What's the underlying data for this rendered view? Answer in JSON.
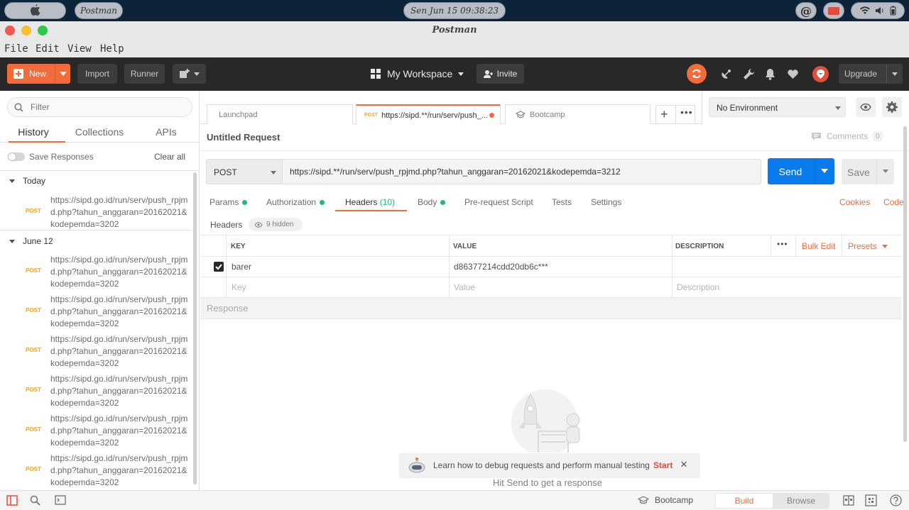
{
  "os": {
    "clock": "Sen Jun 15 09:38:23",
    "app_pill": "Postman"
  },
  "window": {
    "title": "Postman"
  },
  "menu": [
    "File",
    "Edit",
    "View",
    "Help"
  ],
  "header": {
    "new_label": "New",
    "import_label": "Import",
    "runner_label": "Runner",
    "workspace_label": "My Workspace",
    "invite_label": "Invite",
    "upgrade_label": "Upgrade"
  },
  "sidebar": {
    "filter_placeholder": "Filter",
    "tabs": [
      "History",
      "Collections",
      "APIs"
    ],
    "save_responses": "Save Responses",
    "clear_all": "Clear all",
    "groups": [
      {
        "label": "Today"
      },
      {
        "label": "June 12"
      }
    ],
    "items": [
      {
        "method": "POST",
        "url": "https://sipd.go.id/run/serv/push_rpjmd.php?tahun_anggaran=20162021&kodepemda=3202"
      },
      {
        "method": "POST",
        "url": "https://sipd.go.id/run/serv/push_rpjmd.php?tahun_anggaran=20162021&kodepemda=3202"
      },
      {
        "method": "POST",
        "url": "https://sipd.go.id/run/serv/push_rpjmd.php?tahun_anggaran=20162021&kodepemda=3202"
      },
      {
        "method": "POST",
        "url": "https://sipd.go.id/run/serv/push_rpjmd.php?tahun_anggaran=20162021&kodepemda=3202"
      },
      {
        "method": "POST",
        "url": "https://sipd.go.id/run/serv/push_rpjmd.php?tahun_anggaran=20162021&kodepemda=3202"
      },
      {
        "method": "POST",
        "url": "https://sipd.go.id/run/serv/push_rpjmd.php?tahun_anggaran=20162021&kodepemda=3202"
      },
      {
        "method": "POST",
        "url": "https://sipd.go.id/run/serv/push_rpjmd.php?tahun_anggaran=20162021&kodepemda=3202"
      }
    ]
  },
  "tabs": {
    "launchpad": "Launchpad",
    "active_method": "POST",
    "active_label": "https://sipd.**/run/serv/push_...",
    "bootcamp": "Bootcamp"
  },
  "environment": {
    "selected": "No Environment"
  },
  "request": {
    "title": "Untitled Request",
    "comments_label": "Comments",
    "comments_count": "0",
    "method": "POST",
    "url": "https://sipd.**/run/serv/push_rpjmd.php?tahun_anggaran=20162021&kodepemda=3212",
    "send_label": "Send",
    "save_label": "Save"
  },
  "subtabs": {
    "params": "Params",
    "authorization": "Authorization",
    "headers": "Headers",
    "headers_count": "(10)",
    "body": "Body",
    "prerequest": "Pre-request Script",
    "tests": "Tests",
    "settings": "Settings",
    "cookies": "Cookies",
    "code": "Code"
  },
  "headers_section": {
    "label": "Headers",
    "hidden": "9 hidden",
    "col_key": "KEY",
    "col_value": "VALUE",
    "col_description": "DESCRIPTION",
    "bulk_edit": "Bulk Edit",
    "presets": "Presets",
    "row": {
      "key": "barer",
      "value": "d86377214cdd20db6c***"
    },
    "placeholder_key": "Key",
    "placeholder_value": "Value",
    "placeholder_description": "Description"
  },
  "response": {
    "label": "Response",
    "tip": "Learn how to debug requests and perform manual testing",
    "tip_start": "Start",
    "hit_send": "Hit Send to get a response"
  },
  "footer": {
    "bootcamp": "Bootcamp",
    "build": "Build",
    "browse": "Browse"
  },
  "colors": {
    "accent": "#f26b3a",
    "send_blue": "#097bed",
    "header_bg": "#282828",
    "green_dot": "#26b47f"
  }
}
